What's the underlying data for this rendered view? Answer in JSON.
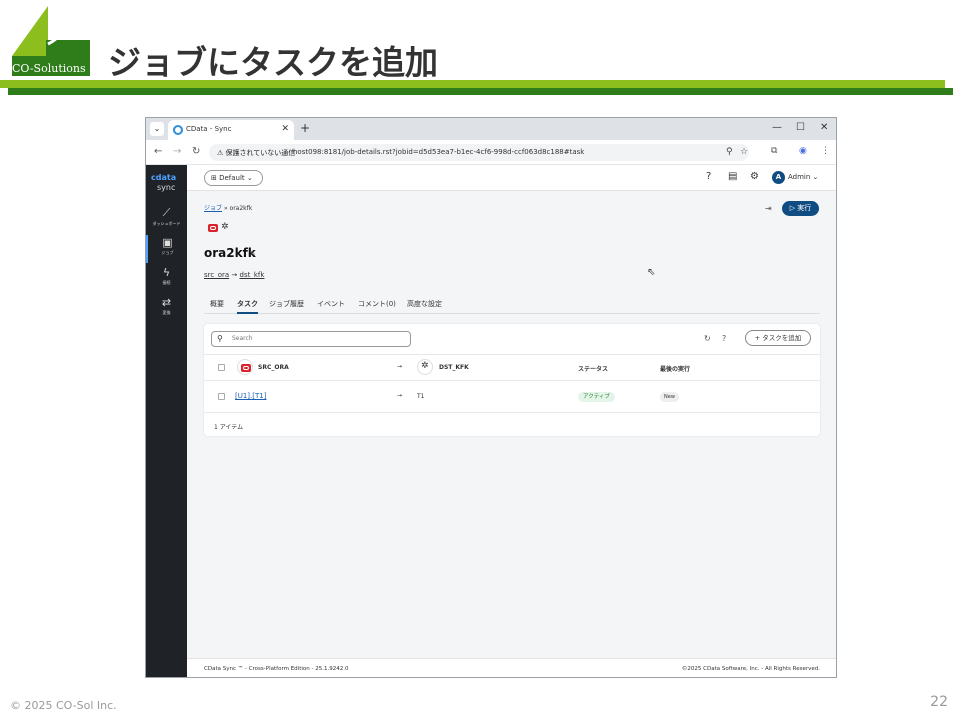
{
  "slide": {
    "title": "ジョブにタスクを追加",
    "logo_text": "CO-Solutions",
    "copyright": "© 2025 CO-Sol Inc.",
    "page_number": "22",
    "colors": {
      "accent_green": "#8cbe1e",
      "dark_green": "#2e7d1a"
    }
  },
  "browser": {
    "tab_title": "CData - Sync",
    "url_warning": "保護されていない通信",
    "url": "host098:8181/job-details.rst?jobid=d5d53ea7-b1ec-4cf6-998d-ccf063d8c188#task"
  },
  "app": {
    "brand_top": "cdata",
    "brand_bottom": "sync",
    "sidebar": [
      {
        "icon": "chart-icon",
        "label": "ダッシュボード"
      },
      {
        "icon": "briefcase-icon",
        "label": "ジョブ"
      },
      {
        "icon": "plug-icon",
        "label": "接続"
      },
      {
        "icon": "transform-icon",
        "label": "変換"
      }
    ],
    "workspace": "Default",
    "user": "Admin",
    "user_initial": "A",
    "breadcrumb": {
      "parent": "ジョブ",
      "sep": "»",
      "current": "ora2kfk"
    },
    "run_button": "実行",
    "job_name": "ora2kfk",
    "source": "src_ora",
    "arrow": "→",
    "destination": "dst_kfk",
    "tabs": [
      "概要",
      "タスク",
      "ジョブ履歴",
      "イベント",
      "コメント(0)",
      "高度な設定"
    ],
    "active_tab": "タスク",
    "search_placeholder": "Search",
    "add_task_button": "タスクを追加",
    "table": {
      "header": {
        "source": "SRC_ORA",
        "destination": "DST_KFK",
        "status": "ステータス",
        "last_run": "最後の実行"
      },
      "rows": [
        {
          "source": "[U1].[T1]",
          "destination": "T1",
          "status": "アクティブ",
          "last_run": "New"
        }
      ],
      "item_count": "1 アイテム"
    },
    "footer_left": "CData Sync ™ - Cross-Platform Edition - 25.1.9242.0",
    "footer_right": "©2025 CData Software, Inc. - All Rights Reserved."
  }
}
